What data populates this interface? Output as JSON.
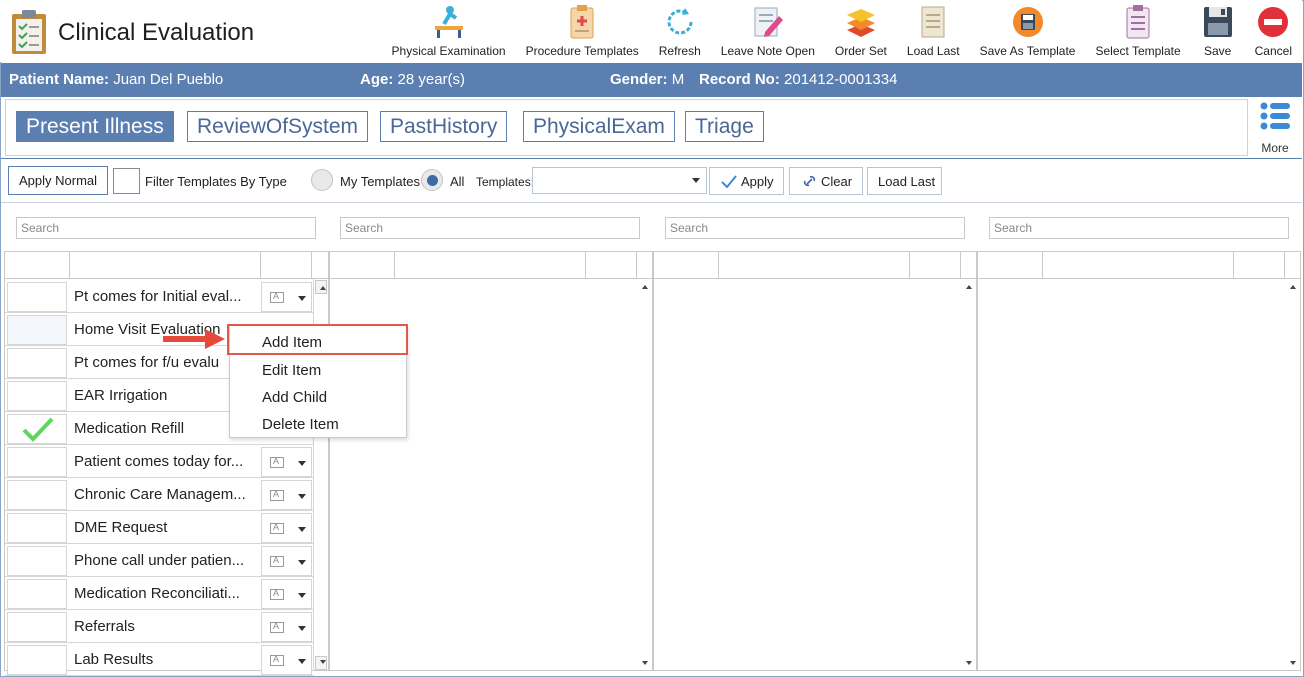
{
  "app": {
    "title": "Clinical Evaluation"
  },
  "toolbar": [
    {
      "label": "Physical Examination",
      "icon": "physical-exam-icon"
    },
    {
      "label": "Procedure Templates",
      "icon": "procedure-templates-icon"
    },
    {
      "label": "Refresh",
      "icon": "refresh-icon"
    },
    {
      "label": "Leave Note Open",
      "icon": "leave-note-open-icon"
    },
    {
      "label": "Order Set",
      "icon": "order-set-icon"
    },
    {
      "label": "Load Last",
      "icon": "load-last-icon"
    },
    {
      "label": "Save As Template",
      "icon": "save-as-template-icon"
    },
    {
      "label": "Select Template",
      "icon": "select-template-icon"
    },
    {
      "label": "Save",
      "icon": "save-icon"
    },
    {
      "label": "Cancel",
      "icon": "cancel-icon"
    }
  ],
  "patient": {
    "name_label": "Patient Name:",
    "name": "Juan Del Pueblo",
    "age_label": "Age:",
    "age": "28 year(s)",
    "gender_label": "Gender:",
    "gender": "M",
    "record_label": "Record No:",
    "record": "201412-0001334"
  },
  "tabs": [
    {
      "label": "Present Illness",
      "active": true
    },
    {
      "label": "ReviewOfSystem",
      "active": false
    },
    {
      "label": "PastHistory",
      "active": false
    },
    {
      "label": "PhysicalExam",
      "active": false
    },
    {
      "label": "Triage",
      "active": false
    }
  ],
  "more_label": "More",
  "filters": {
    "apply_normal": "Apply Normal",
    "filter_by_type": "Filter Templates By Type",
    "my_templates": "My Templates",
    "all": "All",
    "templates_label": "Templates:",
    "templates_value": "",
    "apply": "Apply",
    "clear": "Clear",
    "load_last": "Load Last"
  },
  "search_placeholder": "Search",
  "items": [
    {
      "text": "Pt comes for Initial eval...",
      "checked": false
    },
    {
      "text": "Home Visit Evaluation",
      "checked": false
    },
    {
      "text": "Pt comes for f/u evalu",
      "checked": false
    },
    {
      "text": "EAR Irrigation",
      "checked": false
    },
    {
      "text": "Medication Refill",
      "checked": true
    },
    {
      "text": "Patient comes today for...",
      "checked": false
    },
    {
      "text": "Chronic Care Managem...",
      "checked": false
    },
    {
      "text": "DME Request",
      "checked": false
    },
    {
      "text": "Phone call under patien...",
      "checked": false
    },
    {
      "text": "Medication Reconciliati...",
      "checked": false
    },
    {
      "text": "Referrals",
      "checked": false
    },
    {
      "text": "Lab Results",
      "checked": false
    }
  ],
  "context_menu": [
    {
      "label": "Add Item"
    },
    {
      "label": "Edit Item"
    },
    {
      "label": "Add Child"
    },
    {
      "label": "Delete Item"
    }
  ],
  "colors": {
    "accent": "#5c7fb2",
    "highlight": "#e05a4a",
    "check": "#5cd65c"
  }
}
